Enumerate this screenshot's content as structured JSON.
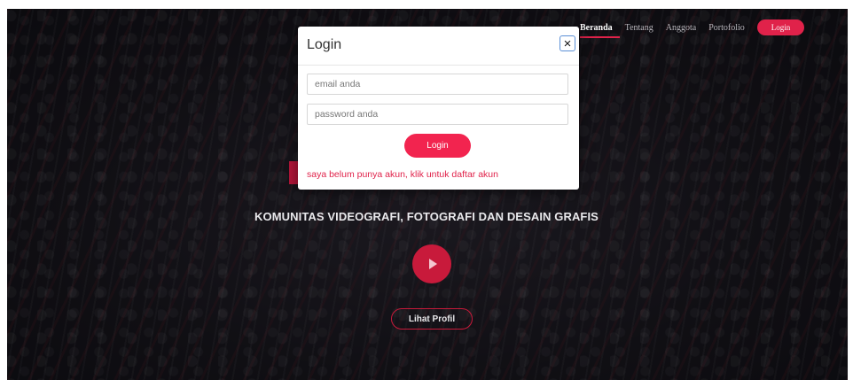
{
  "nav": {
    "items": [
      "Beranda",
      "Tentang",
      "Anggota",
      "Portofolio"
    ],
    "login_label": "Login"
  },
  "hero": {
    "tagline": "KOMUNITAS VIDEOGRAFI, FOTOGRAFI DAN DESAIN GRAFIS",
    "profile_button": "Lihat Profil"
  },
  "modal": {
    "title": "Login",
    "close_symbol": "×",
    "email_placeholder": "email anda",
    "password_placeholder": "password anda",
    "submit_label": "Login",
    "register_text": "saya belum punya akun, klik untuk daftar akun"
  },
  "colors": {
    "accent": "#e0224a",
    "button": "#f2244f",
    "close_border": "#5b8fd6"
  },
  "icons": {
    "close": "close-icon",
    "play": "play-icon"
  }
}
